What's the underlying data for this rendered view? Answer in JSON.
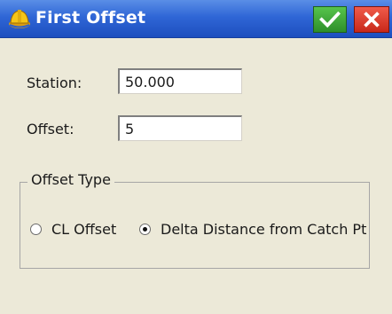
{
  "window": {
    "title": "First Offset",
    "app_icon": "surveyor-hardhat-icon",
    "ok_icon": "checkmark-icon",
    "close_icon": "close-x-icon"
  },
  "form": {
    "station_label": "Station:",
    "station_value": "50.000",
    "offset_label": "Offset:",
    "offset_value": "5"
  },
  "offset_type": {
    "legend": "Offset Type",
    "options": [
      {
        "label": "CL Offset",
        "selected": false
      },
      {
        "label": "Delta Distance from Catch Pt",
        "selected": true
      }
    ]
  },
  "colors": {
    "titlebar": "#2f66d6",
    "ok_button": "#2e8f2a",
    "close_button": "#c8281a",
    "background": "#ece9d8"
  }
}
